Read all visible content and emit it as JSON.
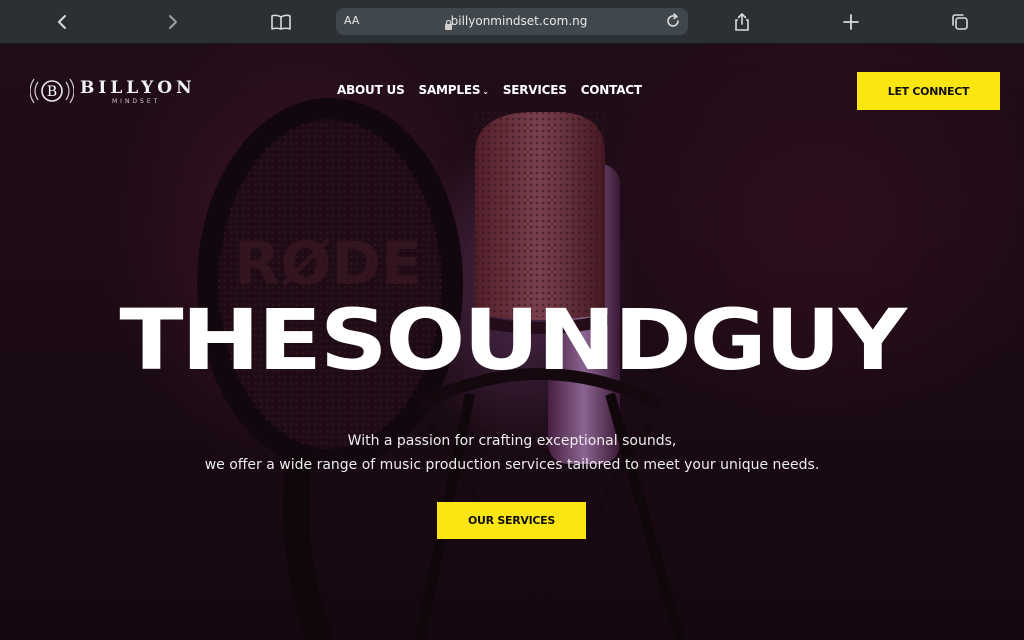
{
  "browser": {
    "text_size_label": "AA",
    "url": "billyonmindset.com.ng",
    "icons": [
      "back-icon",
      "forward-icon",
      "bookmarks-icon",
      "lock-icon",
      "reload-icon",
      "share-icon",
      "new-tab-icon",
      "tabs-icon"
    ]
  },
  "site": {
    "logo": {
      "word": "BILLYON",
      "sub": "MINDSET",
      "monogram": "B"
    },
    "nav": [
      {
        "label": "ABOUT US"
      },
      {
        "label": "SAMPLES",
        "has_dropdown": true
      },
      {
        "label": "SERVICES"
      },
      {
        "label": "CONTACT"
      }
    ],
    "cta_top": "LET CONNECT",
    "hero": {
      "headline": "THESOUNDGUY",
      "tagline_line1": "With a passion for crafting exceptional sounds,",
      "tagline_line2": "we offer a wide range of music production services tailored to meet your unique needs.",
      "cta": "OUR SERVICES"
    },
    "colors": {
      "accent": "#fbe611",
      "text": "#ffffff",
      "background": "#1b0d16"
    }
  }
}
